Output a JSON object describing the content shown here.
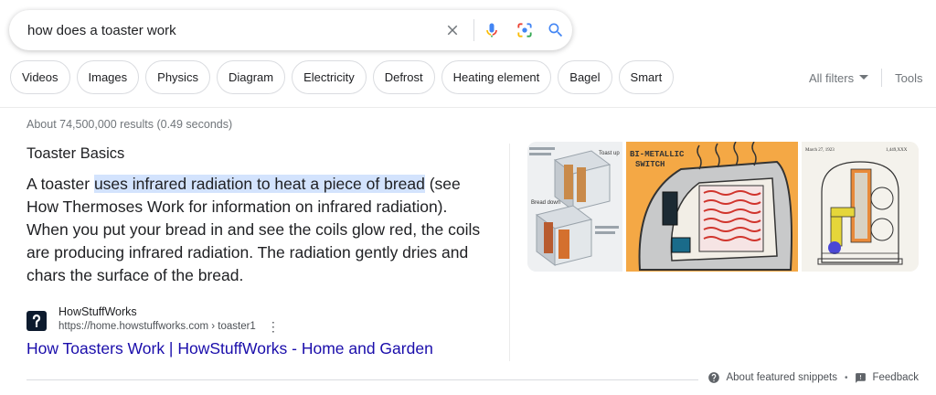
{
  "search": {
    "query": "how does a toaster work",
    "clear_icon": "close-icon",
    "mic_icon": "microphone-icon",
    "lens_icon": "camera-lens-icon",
    "search_icon": "search-icon"
  },
  "chips": [
    "Videos",
    "Images",
    "Physics",
    "Diagram",
    "Electricity",
    "Defrost",
    "Heating element",
    "Bagel",
    "Smart"
  ],
  "toolbar": {
    "all_filters": "All filters",
    "tools": "Tools"
  },
  "result_stats": "About 74,500,000 results (0.49 seconds)",
  "snippet": {
    "title": "Toaster Basics",
    "text_before": "A toaster ",
    "text_highlight": "uses infrared radiation to heat a piece of bread",
    "text_after": " (see How Thermoses Work for information on infrared radiation). When you put your bread in and see the coils glow red, the coils are producing infrared radiation. The radiation gently dries and chars the surface of the bread.",
    "site_name": "HowStuffWorks",
    "site_url": "https://home.howstuffworks.com › toaster1",
    "favicon_text": "?",
    "link_text": "How Toasters Work | HowStuffWorks - Home and Garden"
  },
  "images": [
    {
      "name": "toaster-cutaway-diagram",
      "labels": [
        "Toast up",
        "Bread down"
      ]
    },
    {
      "name": "toaster-bimetallic-switch-illustration",
      "labels": [
        "BI-METALLIC",
        "SWITCH"
      ]
    },
    {
      "name": "toaster-patent-drawing",
      "labels": [
        "March 27, 1923",
        "1,449,XXX"
      ]
    }
  ],
  "footer": {
    "about": "About featured snippets",
    "feedback": "Feedback"
  },
  "colors": {
    "link": "#1a0dab",
    "highlight": "#d3e3fd",
    "mic_blue": "#4285f4",
    "mic_red": "#ea4335"
  }
}
